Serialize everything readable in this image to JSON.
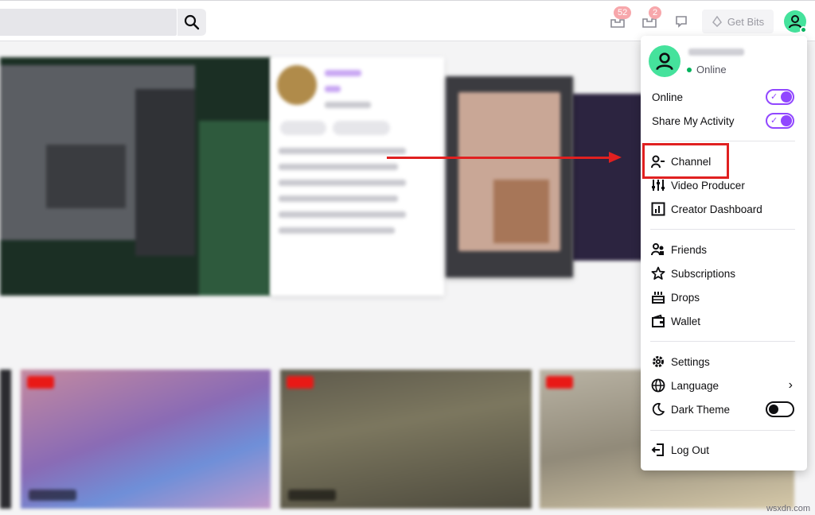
{
  "topbar": {
    "notifications_count": "52",
    "inbox_count": "2",
    "get_bits_label": "Get Bits"
  },
  "menu": {
    "status_label": "Online",
    "toggles": [
      {
        "label": "Online",
        "on": true
      },
      {
        "label": "Share My Activity",
        "on": true
      }
    ],
    "creator_items": [
      "Channel",
      "Video Producer",
      "Creator Dashboard"
    ],
    "social_items": [
      "Friends",
      "Subscriptions",
      "Drops",
      "Wallet"
    ],
    "settings_items": [
      "Settings",
      "Language",
      "Dark Theme"
    ],
    "logout_label": "Log Out"
  },
  "colors": {
    "accent": "#9147ff",
    "annotation": "#e02020",
    "avatar": "#45e29c"
  },
  "watermark": "wsxdn.com"
}
